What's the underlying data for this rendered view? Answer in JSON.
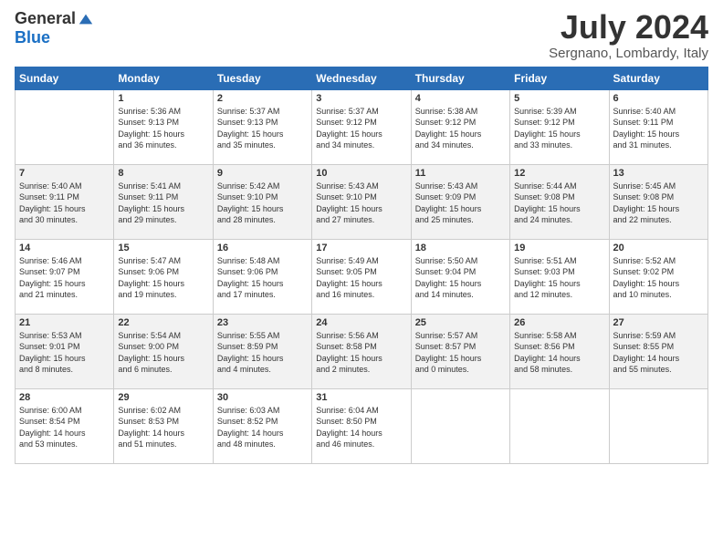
{
  "logo": {
    "general": "General",
    "blue": "Blue"
  },
  "title": "July 2024",
  "location": "Sergnano, Lombardy, Italy",
  "days_of_week": [
    "Sunday",
    "Monday",
    "Tuesday",
    "Wednesday",
    "Thursday",
    "Friday",
    "Saturday"
  ],
  "weeks": [
    [
      {
        "day": "",
        "info": ""
      },
      {
        "day": "1",
        "info": "Sunrise: 5:36 AM\nSunset: 9:13 PM\nDaylight: 15 hours\nand 36 minutes."
      },
      {
        "day": "2",
        "info": "Sunrise: 5:37 AM\nSunset: 9:13 PM\nDaylight: 15 hours\nand 35 minutes."
      },
      {
        "day": "3",
        "info": "Sunrise: 5:37 AM\nSunset: 9:12 PM\nDaylight: 15 hours\nand 34 minutes."
      },
      {
        "day": "4",
        "info": "Sunrise: 5:38 AM\nSunset: 9:12 PM\nDaylight: 15 hours\nand 34 minutes."
      },
      {
        "day": "5",
        "info": "Sunrise: 5:39 AM\nSunset: 9:12 PM\nDaylight: 15 hours\nand 33 minutes."
      },
      {
        "day": "6",
        "info": "Sunrise: 5:40 AM\nSunset: 9:11 PM\nDaylight: 15 hours\nand 31 minutes."
      }
    ],
    [
      {
        "day": "7",
        "info": "Sunrise: 5:40 AM\nSunset: 9:11 PM\nDaylight: 15 hours\nand 30 minutes."
      },
      {
        "day": "8",
        "info": "Sunrise: 5:41 AM\nSunset: 9:11 PM\nDaylight: 15 hours\nand 29 minutes."
      },
      {
        "day": "9",
        "info": "Sunrise: 5:42 AM\nSunset: 9:10 PM\nDaylight: 15 hours\nand 28 minutes."
      },
      {
        "day": "10",
        "info": "Sunrise: 5:43 AM\nSunset: 9:10 PM\nDaylight: 15 hours\nand 27 minutes."
      },
      {
        "day": "11",
        "info": "Sunrise: 5:43 AM\nSunset: 9:09 PM\nDaylight: 15 hours\nand 25 minutes."
      },
      {
        "day": "12",
        "info": "Sunrise: 5:44 AM\nSunset: 9:08 PM\nDaylight: 15 hours\nand 24 minutes."
      },
      {
        "day": "13",
        "info": "Sunrise: 5:45 AM\nSunset: 9:08 PM\nDaylight: 15 hours\nand 22 minutes."
      }
    ],
    [
      {
        "day": "14",
        "info": "Sunrise: 5:46 AM\nSunset: 9:07 PM\nDaylight: 15 hours\nand 21 minutes."
      },
      {
        "day": "15",
        "info": "Sunrise: 5:47 AM\nSunset: 9:06 PM\nDaylight: 15 hours\nand 19 minutes."
      },
      {
        "day": "16",
        "info": "Sunrise: 5:48 AM\nSunset: 9:06 PM\nDaylight: 15 hours\nand 17 minutes."
      },
      {
        "day": "17",
        "info": "Sunrise: 5:49 AM\nSunset: 9:05 PM\nDaylight: 15 hours\nand 16 minutes."
      },
      {
        "day": "18",
        "info": "Sunrise: 5:50 AM\nSunset: 9:04 PM\nDaylight: 15 hours\nand 14 minutes."
      },
      {
        "day": "19",
        "info": "Sunrise: 5:51 AM\nSunset: 9:03 PM\nDaylight: 15 hours\nand 12 minutes."
      },
      {
        "day": "20",
        "info": "Sunrise: 5:52 AM\nSunset: 9:02 PM\nDaylight: 15 hours\nand 10 minutes."
      }
    ],
    [
      {
        "day": "21",
        "info": "Sunrise: 5:53 AM\nSunset: 9:01 PM\nDaylight: 15 hours\nand 8 minutes."
      },
      {
        "day": "22",
        "info": "Sunrise: 5:54 AM\nSunset: 9:00 PM\nDaylight: 15 hours\nand 6 minutes."
      },
      {
        "day": "23",
        "info": "Sunrise: 5:55 AM\nSunset: 8:59 PM\nDaylight: 15 hours\nand 4 minutes."
      },
      {
        "day": "24",
        "info": "Sunrise: 5:56 AM\nSunset: 8:58 PM\nDaylight: 15 hours\nand 2 minutes."
      },
      {
        "day": "25",
        "info": "Sunrise: 5:57 AM\nSunset: 8:57 PM\nDaylight: 15 hours\nand 0 minutes."
      },
      {
        "day": "26",
        "info": "Sunrise: 5:58 AM\nSunset: 8:56 PM\nDaylight: 14 hours\nand 58 minutes."
      },
      {
        "day": "27",
        "info": "Sunrise: 5:59 AM\nSunset: 8:55 PM\nDaylight: 14 hours\nand 55 minutes."
      }
    ],
    [
      {
        "day": "28",
        "info": "Sunrise: 6:00 AM\nSunset: 8:54 PM\nDaylight: 14 hours\nand 53 minutes."
      },
      {
        "day": "29",
        "info": "Sunrise: 6:02 AM\nSunset: 8:53 PM\nDaylight: 14 hours\nand 51 minutes."
      },
      {
        "day": "30",
        "info": "Sunrise: 6:03 AM\nSunset: 8:52 PM\nDaylight: 14 hours\nand 48 minutes."
      },
      {
        "day": "31",
        "info": "Sunrise: 6:04 AM\nSunset: 8:50 PM\nDaylight: 14 hours\nand 46 minutes."
      },
      {
        "day": "",
        "info": ""
      },
      {
        "day": "",
        "info": ""
      },
      {
        "day": "",
        "info": ""
      }
    ]
  ]
}
